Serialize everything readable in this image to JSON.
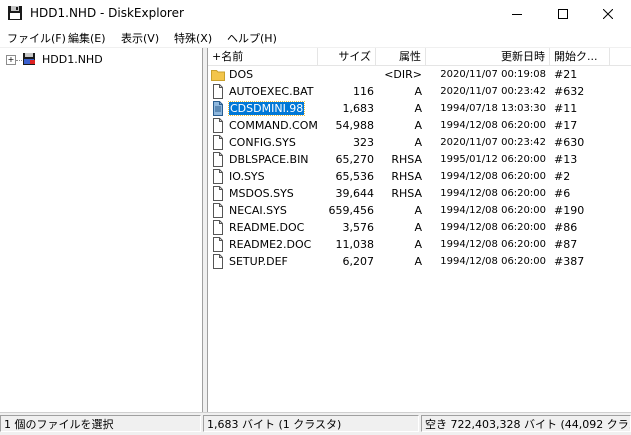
{
  "window": {
    "title": "HDD1.NHD - DiskExplorer",
    "minimize_glyph": "—",
    "maximize_glyph": "☐",
    "close_glyph": "✕"
  },
  "menu": [
    {
      "label": "ファイル(F)"
    },
    {
      "label": "編集(E)"
    },
    {
      "label": "表示(V)"
    },
    {
      "label": "特殊(X)"
    },
    {
      "label": "ヘルプ(H)"
    }
  ],
  "tree": {
    "expander": "+",
    "root_label": "HDD1.NHD",
    "root_icon": "disk-drive-icon"
  },
  "list": {
    "columns": [
      {
        "label": "+名前"
      },
      {
        "label": "サイズ"
      },
      {
        "label": "属性"
      },
      {
        "label": "更新日時"
      },
      {
        "label": "開始ク..."
      }
    ],
    "rows": [
      {
        "name": "DOS",
        "size": "",
        "attr": "<DIR>",
        "date": "2020/11/07 00:19:08",
        "start": "#21",
        "icon": "folder-icon"
      },
      {
        "name": "AUTOEXEC.BAT",
        "size": "116",
        "attr": "A",
        "date": "2020/11/07 00:23:42",
        "start": "#632",
        "icon": "file-icon"
      },
      {
        "name": "CDSDMINI.98",
        "size": "1,683",
        "attr": "A",
        "date": "1994/07/18 13:03:30",
        "start": "#11",
        "icon": "file-icon",
        "selected": true
      },
      {
        "name": "COMMAND.COM",
        "size": "54,988",
        "attr": "A",
        "date": "1994/12/08 06:20:00",
        "start": "#17",
        "icon": "file-icon"
      },
      {
        "name": "CONFIG.SYS",
        "size": "323",
        "attr": "A",
        "date": "2020/11/07 00:23:42",
        "start": "#630",
        "icon": "file-icon"
      },
      {
        "name": "DBLSPACE.BIN",
        "size": "65,270",
        "attr": "RHSA",
        "date": "1995/01/12 06:20:00",
        "start": "#13",
        "icon": "file-icon"
      },
      {
        "name": "IO.SYS",
        "size": "65,536",
        "attr": "RHSA",
        "date": "1994/12/08 06:20:00",
        "start": "#2",
        "icon": "file-icon"
      },
      {
        "name": "MSDOS.SYS",
        "size": "39,644",
        "attr": "RHSA",
        "date": "1994/12/08 06:20:00",
        "start": "#6",
        "icon": "file-icon"
      },
      {
        "name": "NECAI.SYS",
        "size": "659,456",
        "attr": "A",
        "date": "1994/12/08 06:20:00",
        "start": "#190",
        "icon": "file-icon"
      },
      {
        "name": "README.DOC",
        "size": "3,576",
        "attr": "A",
        "date": "1994/12/08 06:20:00",
        "start": "#86",
        "icon": "file-icon"
      },
      {
        "name": "README2.DOC",
        "size": "11,038",
        "attr": "A",
        "date": "1994/12/08 06:20:00",
        "start": "#87",
        "icon": "file-icon"
      },
      {
        "name": "SETUP.DEF",
        "size": "6,207",
        "attr": "A",
        "date": "1994/12/08 06:20:00",
        "start": "#387",
        "icon": "file-icon"
      }
    ]
  },
  "status": {
    "selection": "1 個のファイルを選択",
    "size": "1,683 バイト (1 クラスタ)",
    "free": "空き 722,403,328 バイト (44,092 クラス"
  },
  "colors": {
    "selection": "#0078d7",
    "folder": "#f3c54a",
    "statusbar": "#f0f0f0"
  }
}
